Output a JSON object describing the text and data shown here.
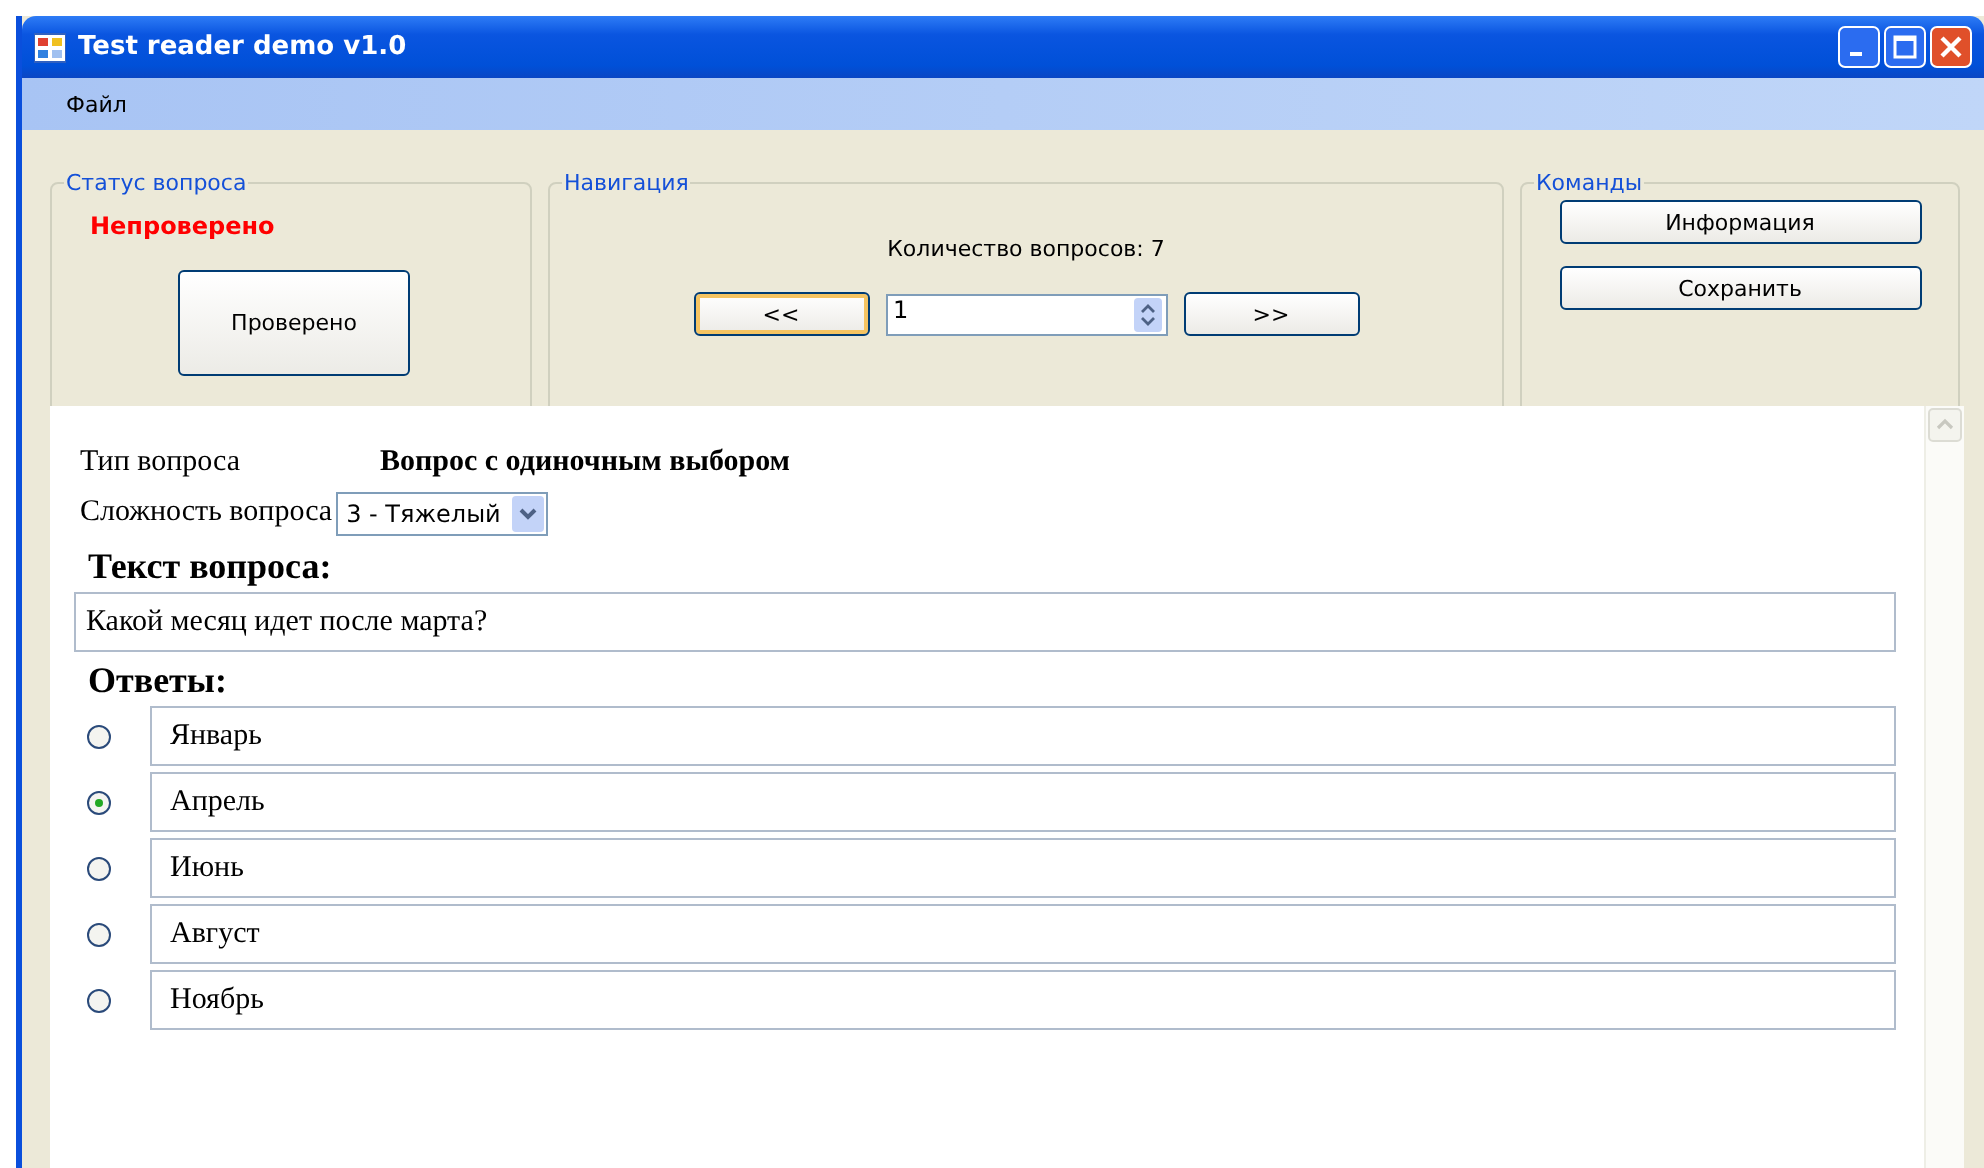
{
  "window": {
    "title": "Test reader demo v1.0"
  },
  "menu": [
    "Файл"
  ],
  "status_group": {
    "title": "Статус вопроса",
    "status": "Непроверено",
    "button": "Проверено"
  },
  "navigation": {
    "title": "Навигация",
    "count_label": "Количество вопросов: 7",
    "prev": "<<",
    "question_number": "1",
    "next": ">>"
  },
  "commands": {
    "title": "Команды",
    "buttons": [
      "Информация",
      "Сохранить"
    ]
  },
  "question": {
    "type_label": "Тип вопроса",
    "type_value": "Вопрос с одиночным выбором",
    "difficulty_label": "Сложность вопроса",
    "difficulty_value": "3 - Тяжелый",
    "text_heading": "Текст вопроса:",
    "text": "Какой месяц идет после марта?",
    "answers_heading": "Ответы:",
    "answers": [
      {
        "text": "Январь",
        "selected": false
      },
      {
        "text": "Апрель",
        "selected": true
      },
      {
        "text": "Июнь",
        "selected": false
      },
      {
        "text": "Август",
        "selected": false
      },
      {
        "text": "Ноябрь",
        "selected": false
      }
    ]
  }
}
